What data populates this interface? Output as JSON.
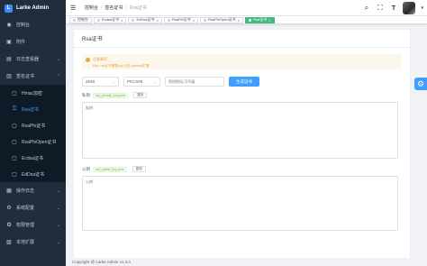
{
  "app": {
    "title": "Larke Admin",
    "logo_letter": "L"
  },
  "sidebar": {
    "items": [
      {
        "label": "控制台",
        "icon": "dashboard-icon",
        "glyph": "◉"
      },
      {
        "label": "附件",
        "icon": "attachment-icon",
        "glyph": "▣"
      },
      {
        "label": "日志查看器",
        "icon": "log-icon",
        "glyph": "▤",
        "has_arrow": true
      },
      {
        "label": "签名证书",
        "icon": "certificate-icon",
        "glyph": "▥",
        "has_arrow": true,
        "expanded": true
      }
    ],
    "submenu": [
      {
        "label": "Hmac加密",
        "icon": "lock-icon",
        "glyph": "▢"
      },
      {
        "label": "Rsa证书",
        "icon": "key-icon",
        "glyph": "⚿",
        "active": true
      },
      {
        "label": "RsaPfx证书",
        "icon": "key-icon",
        "glyph": "▢"
      },
      {
        "label": "RsaPfxOpen证书",
        "icon": "key-icon",
        "glyph": "▢"
      },
      {
        "label": "Ecdsa证书",
        "icon": "key-icon",
        "glyph": "▢"
      },
      {
        "label": "EdDsa证书",
        "icon": "key-icon",
        "glyph": "▢"
      }
    ],
    "bottom_items": [
      {
        "label": "操作日志",
        "icon": "operation-log-icon",
        "glyph": "▦",
        "has_arrow": true
      },
      {
        "label": "系统配置",
        "icon": "settings-icon",
        "glyph": "⚙",
        "has_arrow": true
      },
      {
        "label": "权限管理",
        "icon": "permission-icon",
        "glyph": "✪",
        "has_arrow": true
      },
      {
        "label": "本地扩展",
        "icon": "extension-icon",
        "glyph": "▧",
        "has_arrow": true
      }
    ]
  },
  "header": {
    "breadcrumb": [
      "控制台",
      "签名证书",
      "Rsa证书"
    ]
  },
  "tags": [
    {
      "label": "控制台",
      "active": false
    },
    {
      "label": "Ecdsa证书",
      "active": false
    },
    {
      "label": "EdDsa证书",
      "active": false
    },
    {
      "label": "RsaPfx证书",
      "active": false
    },
    {
      "label": "RsaPfxOpen证书",
      "active": false
    },
    {
      "label": "Rsa证书",
      "active": true
    }
  ],
  "card": {
    "title": "Rsa证书",
    "alert_title": "注意事项",
    "alert_desc": "Rsa, rsa证书需要php 开启 openssl扩展",
    "key_length": "2048",
    "format": "PKCS#8",
    "passphrase_placeholder": "密钥密码,可不填",
    "generate_label": "生成证书",
    "private_label": "私钥",
    "private_file": "rsa_private_key.pem",
    "copy_label": "复制",
    "private_placeholder": "私钥",
    "public_label": "公钥",
    "public_file": "rsa_public_key.pem",
    "public_placeholder": "公钥"
  },
  "footer": {
    "text": "Copyright @ Larke Admin v1.3.0"
  }
}
